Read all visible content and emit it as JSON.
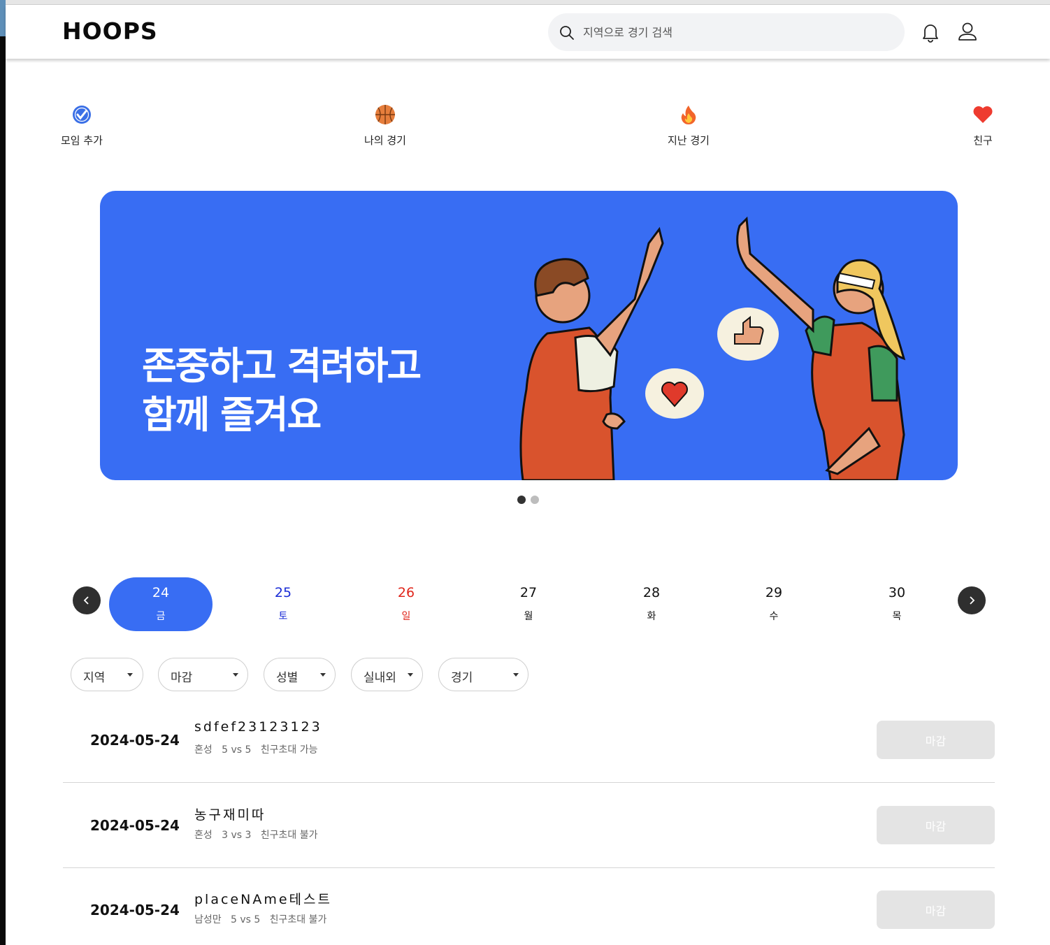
{
  "header": {
    "logo": "HOOPS",
    "search_placeholder": "지역으로 경기 검색"
  },
  "quick_menu": [
    {
      "label": "모임 추가",
      "icon": "blue-check-badge-icon"
    },
    {
      "label": "나의 경기",
      "icon": "basketball-icon"
    },
    {
      "label": "지난 경기",
      "icon": "fire-icon"
    },
    {
      "label": "친구",
      "icon": "heart-icon"
    }
  ],
  "banner": {
    "line1": "존중하고 격려하고",
    "line2": "함께 즐겨요",
    "slide_count": 2,
    "active_slide": 1,
    "color": "#386df3"
  },
  "calendar": {
    "days": [
      {
        "num": "24",
        "dow": "금",
        "selected": true
      },
      {
        "num": "25",
        "dow": "토",
        "color": "#1a2cd6"
      },
      {
        "num": "26",
        "dow": "일",
        "color": "#e0261b"
      },
      {
        "num": "27",
        "dow": "월"
      },
      {
        "num": "28",
        "dow": "화"
      },
      {
        "num": "29",
        "dow": "수"
      },
      {
        "num": "30",
        "dow": "목"
      }
    ]
  },
  "filters": [
    "지역",
    "마감",
    "성별",
    "실내외",
    "경기"
  ],
  "matches": [
    {
      "date": "2024-05-24",
      "name": "sdfef23123123",
      "gender": "혼성",
      "format": "5 vs 5",
      "invite": "친구초대 가능",
      "status": "마감"
    },
    {
      "date": "2024-05-24",
      "name": "농구재미따",
      "gender": "혼성",
      "format": "3 vs 3",
      "invite": "친구초대 불가",
      "status": "마감"
    },
    {
      "date": "2024-05-24",
      "name": "placeNAme테스트",
      "gender": "남성만",
      "format": "5 vs 5",
      "invite": "친구초대 불가",
      "status": "마감"
    }
  ]
}
